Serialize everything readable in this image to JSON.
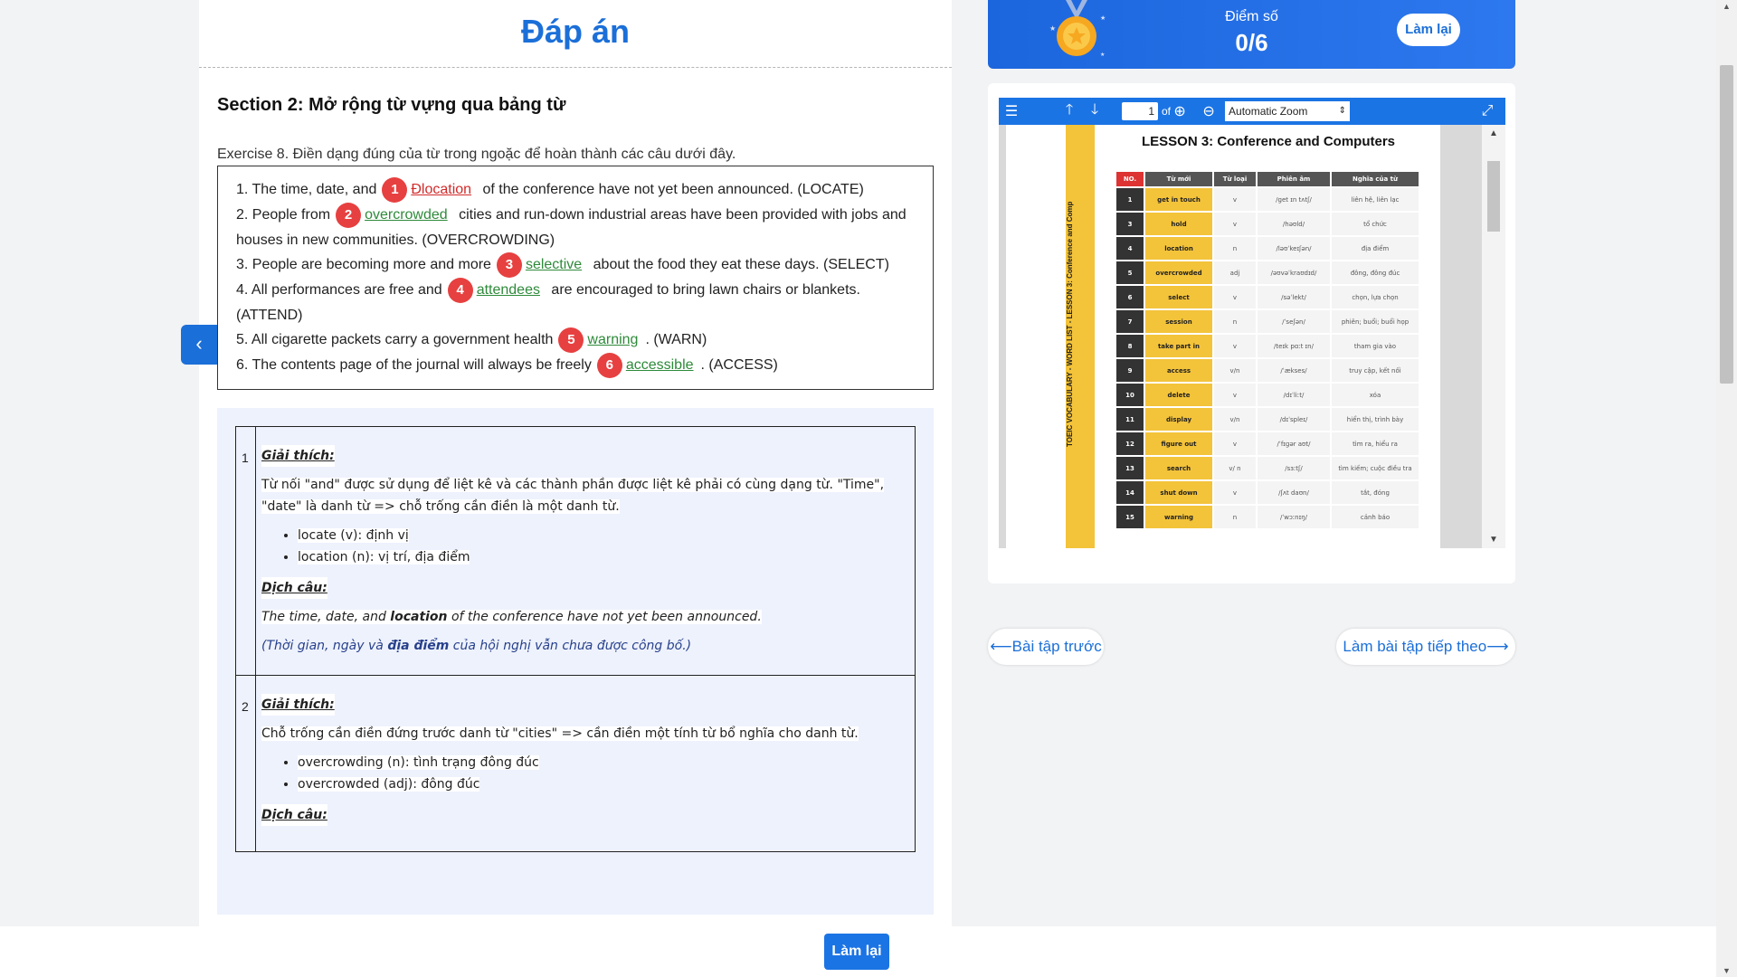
{
  "answers_title": "Đáp án",
  "section_title": "Section 2: Mở rộng từ vựng qua bảng từ",
  "exercise_instruction": "Exercise 8. Điền dạng đúng của từ trong ngoặc để hoàn thành các câu dưới đây.",
  "questions": [
    {
      "num": "1",
      "before": "1. The time, date, and",
      "answer": "Đlocation",
      "after": "of the conference have not yet been announced. (LOCATE)"
    },
    {
      "num": "2",
      "before": "2. People from",
      "answer": "overcrowded",
      "after": "cities and run-down industrial areas have been provided with jobs and houses in new communities. (OVERCROWDING)"
    },
    {
      "num": "3",
      "before": "3. People are becoming more and more",
      "answer": "selective",
      "after": "about the food they eat these days. (SELECT)"
    },
    {
      "num": "4",
      "before": "4. All performances are free and",
      "answer": "attendees",
      "after": "are encouraged to bring lawn chairs or blankets. (ATTEND)"
    },
    {
      "num": "5",
      "before": "5. All cigarette packets carry a government health",
      "answer": "warning",
      "after": ". (WARN)"
    },
    {
      "num": "6",
      "before": "6. The contents page of the journal will always be freely",
      "answer": "accessible",
      "after": ". (ACCESS)"
    }
  ],
  "explanations": [
    {
      "num": "1",
      "explain_head": "Giải thích:",
      "explain_text": "Từ nối \"and\" được sử dụng để liệt kê và các thành phần được liệt kê phải có cùng dạng từ. \"Time\", \"date\" là danh từ => chỗ trống cần điền là một danh từ.",
      "bullets": [
        "locate (v): định vị",
        "location (n): vị trí, địa điểm"
      ],
      "translate_head": "Dịch câu:",
      "sentence_before": "The time, date, and ",
      "sentence_bold": "location",
      "sentence_after": " of the conference have not yet been announced.",
      "trans_before": "(Thời gian, ngày và ",
      "trans_bold": "địa điểm",
      "trans_after": " của hội nghị vẫn chưa được công bố.)"
    },
    {
      "num": "2",
      "explain_head": "Giải thích:",
      "explain_text": "Chỗ trống cần điền đứng trước danh từ \"cities\" => cần điền một tính từ bổ nghĩa cho danh từ.",
      "bullets": [
        "overcrowding (n): tình trạng đông đúc",
        "overcrowded (adj): đông đúc"
      ],
      "translate_head": "Dịch câu:"
    }
  ],
  "score": {
    "label": "Điểm số",
    "value": "0/6",
    "retry": "Làm lại"
  },
  "pdf": {
    "page": "1",
    "of": "of",
    "zoom": "Automatic Zoom",
    "side_text": "TOEIC VOCABULARY - WORD LIST - LESSON 3: Conference and Comp",
    "lesson_title": "LESSON 3: Conference and Computers",
    "headers": [
      "NO.",
      "Từ mới",
      "Từ loại",
      "Phiên âm",
      "Nghĩa của từ"
    ],
    "rows": [
      [
        "1",
        "get in touch",
        "v",
        "/ɡet ɪn tʌtʃ/",
        "liên hệ, liên lạc"
      ],
      [
        "3",
        "hold",
        "v",
        "/həʊld/",
        "tổ chức"
      ],
      [
        "4",
        "location",
        "n",
        "/ləʊˈkeɪʃən/",
        "địa điểm"
      ],
      [
        "5",
        "overcrowded",
        "adj",
        "/əʊvəˈkraʊdɪd/",
        "đông, đông đúc"
      ],
      [
        "6",
        "select",
        "v",
        "/səˈlekt/",
        "chọn, lựa chọn"
      ],
      [
        "7",
        "session",
        "n",
        "/ˈseʃən/",
        "phiên; buổi; buổi họp"
      ],
      [
        "8",
        "take part in",
        "v",
        "/teɪk pɑːt ɪn/",
        "tham gia vào"
      ],
      [
        "9",
        "access",
        "v/n",
        "/ˈækses/",
        "truy cập, kết nối"
      ],
      [
        "10",
        "delete",
        "v",
        "/dɪˈliːt/",
        "xóa"
      ],
      [
        "11",
        "display",
        "v/n",
        "/dɪˈspleɪ/",
        "hiển thị, trình bày"
      ],
      [
        "12",
        "figure out",
        "v",
        "/ˈfɪɡər aʊt/",
        "tìm ra, hiểu ra"
      ],
      [
        "13",
        "search",
        "v/ n",
        "/sɜːtʃ/",
        "tìm kiếm; cuộc điều tra"
      ],
      [
        "14",
        "shut down",
        "v",
        "/ʃʌt daʊn/",
        "tắt, đóng"
      ],
      [
        "15",
        "warning",
        "n",
        "/ˈwɔːnɪŋ/",
        "cảnh báo"
      ]
    ]
  },
  "nav": {
    "prev": "⟵Bài tập trước",
    "next": "Làm bài tập tiếp theo⟶"
  },
  "bottom": {
    "retry": "Làm lại"
  },
  "colors": {
    "accent": "#1b6fd8",
    "correct": "#2e8a3a",
    "wrong": "#d22a2a",
    "badge": "#e74040"
  }
}
